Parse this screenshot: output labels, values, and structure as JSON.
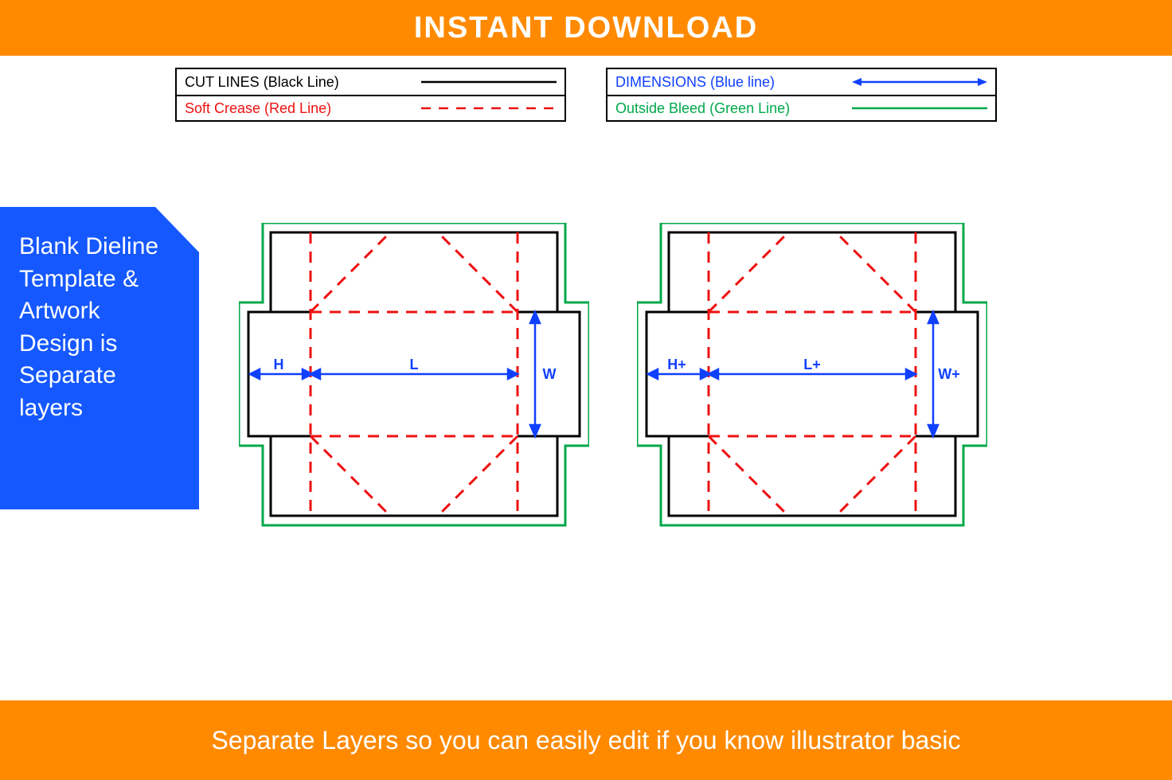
{
  "banner_top": "INSTANT DOWNLOAD",
  "legend": {
    "left": [
      {
        "label": "CUT LINES (Black Line)",
        "color": "black"
      },
      {
        "label": "Soft Crease (Red Line)",
        "color": "red"
      }
    ],
    "right": [
      {
        "label": "DIMENSIONS (Blue line)",
        "color": "blue"
      },
      {
        "label": "Outside Bleed (Green Line)",
        "color": "green"
      }
    ]
  },
  "side_tag": "Blank Dieline Template & Artwork Design is Separate layers",
  "diagram_left": {
    "h": "H",
    "l": "L",
    "w": "W"
  },
  "diagram_right": {
    "h": "H+",
    "l": "L+",
    "w": "W+"
  },
  "banner_bottom": "Separate Layers so you can easily edit if you know illustrator basic"
}
